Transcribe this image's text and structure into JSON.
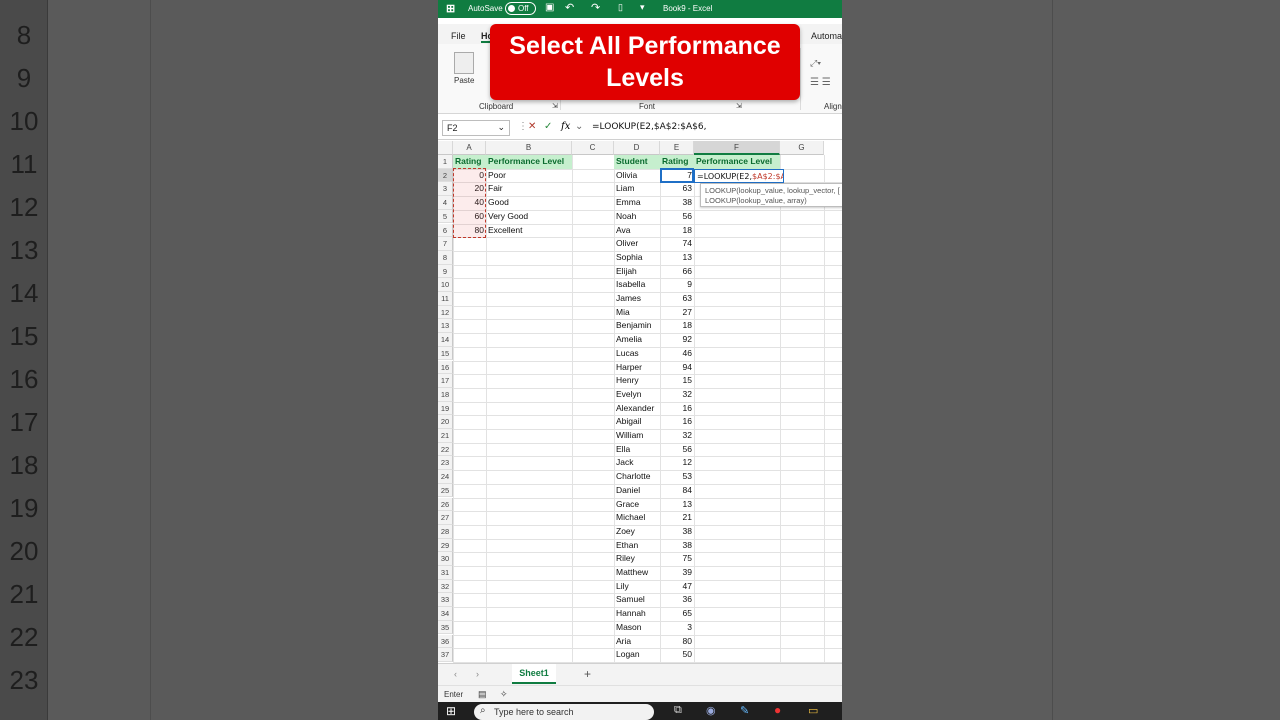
{
  "app": {
    "autosave_label": "AutoSave",
    "autosave_state": "Off",
    "window_title": "Book9  -  Excel"
  },
  "ribbon": {
    "tabs": [
      "File",
      "Ho",
      "Automa"
    ],
    "paste_label": "Paste",
    "groups": [
      "Clipboard",
      "Font",
      "Align"
    ]
  },
  "formula_bar": {
    "name_box": "F2",
    "formula": "=LOOKUP(E2,$A$2:$A$6,"
  },
  "banner": {
    "text": "Select All Performance Levels"
  },
  "columns": [
    "A",
    "B",
    "C",
    "D",
    "E",
    "F",
    "G"
  ],
  "lookup_table": {
    "headers": [
      "Rating",
      "Performance Level"
    ],
    "rows": [
      {
        "rating": "0",
        "level": "Poor"
      },
      {
        "rating": "20",
        "level": "Fair"
      },
      {
        "rating": "40",
        "level": "Good"
      },
      {
        "rating": "60",
        "level": "Very Good"
      },
      {
        "rating": "80",
        "level": "Excellent"
      }
    ]
  },
  "students_table": {
    "headers": [
      "Student",
      "Rating",
      "Performance Level"
    ],
    "rows": [
      {
        "name": "Olivia",
        "rating": "7"
      },
      {
        "name": "Liam",
        "rating": "63"
      },
      {
        "name": "Emma",
        "rating": "38"
      },
      {
        "name": "Noah",
        "rating": "56"
      },
      {
        "name": "Ava",
        "rating": "18"
      },
      {
        "name": "Oliver",
        "rating": "74"
      },
      {
        "name": "Sophia",
        "rating": "13"
      },
      {
        "name": "Elijah",
        "rating": "66"
      },
      {
        "name": "Isabella",
        "rating": "9"
      },
      {
        "name": "James",
        "rating": "63"
      },
      {
        "name": "Mia",
        "rating": "27"
      },
      {
        "name": "Benjamin",
        "rating": "18"
      },
      {
        "name": "Amelia",
        "rating": "92"
      },
      {
        "name": "Lucas",
        "rating": "46"
      },
      {
        "name": "Harper",
        "rating": "94"
      },
      {
        "name": "Henry",
        "rating": "15"
      },
      {
        "name": "Evelyn",
        "rating": "32"
      },
      {
        "name": "Alexander",
        "rating": "16"
      },
      {
        "name": "Abigail",
        "rating": "16"
      },
      {
        "name": "William",
        "rating": "32"
      },
      {
        "name": "Ella",
        "rating": "56"
      },
      {
        "name": "Jack",
        "rating": "12"
      },
      {
        "name": "Charlotte",
        "rating": "53"
      },
      {
        "name": "Daniel",
        "rating": "84"
      },
      {
        "name": "Grace",
        "rating": "13"
      },
      {
        "name": "Michael",
        "rating": "21"
      },
      {
        "name": "Zoey",
        "rating": "38"
      },
      {
        "name": "Ethan",
        "rating": "38"
      },
      {
        "name": "Riley",
        "rating": "75"
      },
      {
        "name": "Matthew",
        "rating": "39"
      },
      {
        "name": "Lily",
        "rating": "47"
      },
      {
        "name": "Samuel",
        "rating": "36"
      },
      {
        "name": "Hannah",
        "rating": "65"
      },
      {
        "name": "Mason",
        "rating": "3"
      },
      {
        "name": "Aria",
        "rating": "80"
      },
      {
        "name": "Logan",
        "rating": "50"
      }
    ]
  },
  "edit_cell": {
    "prefix": "=LOOKUP(E2,",
    "range": "$A$2:$A$6",
    "suffix": ","
  },
  "tooltip": {
    "line1": "LOOKUP(lookup_value, lookup_vector, [",
    "line2": "LOOKUP(lookup_value, array)"
  },
  "row_count": 37,
  "sheet_tab": "Sheet1",
  "status": {
    "mode": "Enter"
  },
  "taskbar": {
    "search_placeholder": "Type here to search"
  },
  "bg_row_numbers": [
    "8",
    "9",
    "10",
    "11",
    "12",
    "13",
    "14",
    "15",
    "16",
    "17",
    "18",
    "19",
    "20",
    "21",
    "22",
    "23"
  ],
  "colors": {
    "excel_green": "#107c41",
    "header_fill": "#c6efce",
    "banner_red": "#e00000",
    "range_border": "#c0392b",
    "active_border": "#1f6fc6"
  }
}
